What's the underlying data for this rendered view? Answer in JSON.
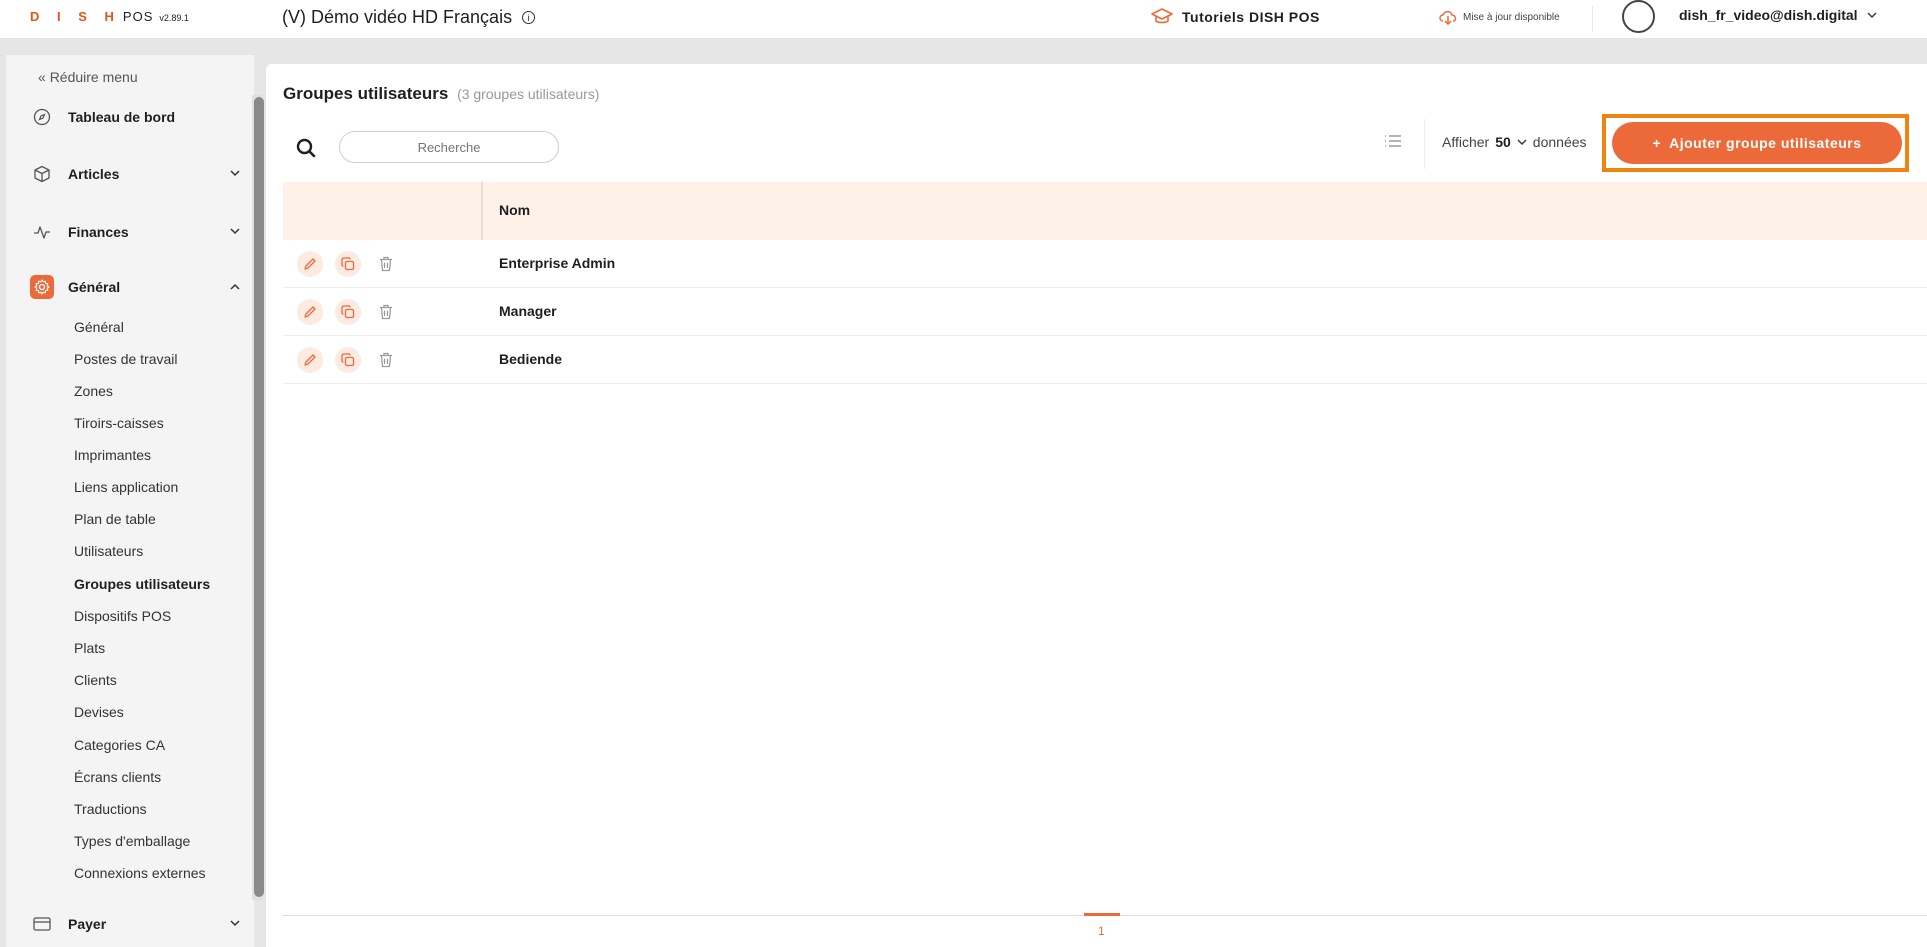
{
  "topbar": {
    "brand_dish": "D I S H",
    "brand_pos": "POS",
    "version": "v2.89.1",
    "project_title": "(V) Démo vidéo HD Français",
    "tutorials_label": "Tutoriels DISH POS",
    "update_label": "Mise à jour disponible",
    "user_email": "dish_fr_video@dish.digital"
  },
  "sidebar": {
    "collapse_label": "Réduire menu",
    "collapse_prefix": "«",
    "main_items": [
      {
        "label": "Tableau de bord",
        "icon": "compass-icon",
        "expandable": false
      },
      {
        "label": "Articles",
        "icon": "box-icon",
        "expandable": true
      },
      {
        "label": "Finances",
        "icon": "activity-icon",
        "expandable": true
      },
      {
        "label": "Général",
        "icon": "gear-icon",
        "expandable": true,
        "active": true
      },
      {
        "label": "Payer",
        "icon": "card-icon",
        "expandable": true
      }
    ],
    "sub_items": [
      "Général",
      "Postes de travail",
      "Zones",
      "Tiroirs-caisses",
      "Imprimantes",
      "Liens application",
      "Plan de table",
      "Utilisateurs",
      "Groupes utilisateurs",
      "Dispositifs POS",
      "Plats",
      "Clients",
      "Devises",
      "Categories CA",
      "Écrans clients",
      "Traductions",
      "Types d'emballage",
      "Connexions externes"
    ],
    "active_sub": "Groupes utilisateurs"
  },
  "main": {
    "title": "Groupes utilisateurs",
    "count_text": "(3 groupes utilisateurs)",
    "search_placeholder": "Recherche",
    "show_label": "Afficher",
    "show_value": "50",
    "show_suffix": "données",
    "add_button_label": "Ajouter groupe utilisateurs",
    "add_button_prefix": "+",
    "table": {
      "columns": [
        "Nom"
      ],
      "rows": [
        {
          "name": "Enterprise Admin"
        },
        {
          "name": "Manager"
        },
        {
          "name": "Bediende"
        }
      ]
    },
    "current_page": "1"
  },
  "colors": {
    "accent": "#ec6a3a",
    "highlight_frame": "#f08410",
    "header_bg": "#fdf1e8"
  }
}
